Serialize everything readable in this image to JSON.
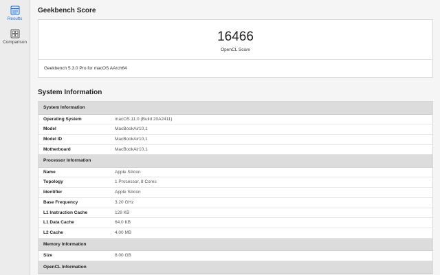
{
  "sidebar": {
    "items": [
      {
        "label": "Results",
        "icon": "results-icon",
        "selected": true
      },
      {
        "label": "Comparison",
        "icon": "comparison-icon",
        "selected": false
      }
    ]
  },
  "score_section": {
    "title": "Geekbench Score",
    "score": "16466",
    "score_label": "OpenCL Score",
    "version": "Geekbench 5.3.0 Pro for macOS AArch64"
  },
  "system_section": {
    "title": "System Information",
    "groups": [
      {
        "header": "System Information",
        "rows": [
          {
            "key": "Operating System",
            "value": "macOS 11.0 (Build 20A2411)"
          },
          {
            "key": "Model",
            "value": "MacBookAir10,1"
          },
          {
            "key": "Model ID",
            "value": "MacBookAir10,1"
          },
          {
            "key": "Motherboard",
            "value": "MacBookAir10,1"
          }
        ]
      },
      {
        "header": "Processor Information",
        "rows": [
          {
            "key": "Name",
            "value": "Apple Silicon"
          },
          {
            "key": "Topology",
            "value": "1 Processor, 8 Cores"
          },
          {
            "key": "Identifier",
            "value": "Apple Silicon"
          },
          {
            "key": "Base Frequency",
            "value": "3.20 GHz"
          },
          {
            "key": "L1 Instruction Cache",
            "value": "128 KB"
          },
          {
            "key": "L1 Data Cache",
            "value": "64.0 KB"
          },
          {
            "key": "L2 Cache",
            "value": "4.00 MB"
          }
        ]
      },
      {
        "header": "Memory Information",
        "rows": [
          {
            "key": "Size",
            "value": "8.00 GB"
          }
        ]
      },
      {
        "header": "OpenCL Information",
        "rows": []
      }
    ]
  },
  "colors": {
    "accent": "#1f6fd1",
    "group_header_bg": "#dcdcdc"
  }
}
